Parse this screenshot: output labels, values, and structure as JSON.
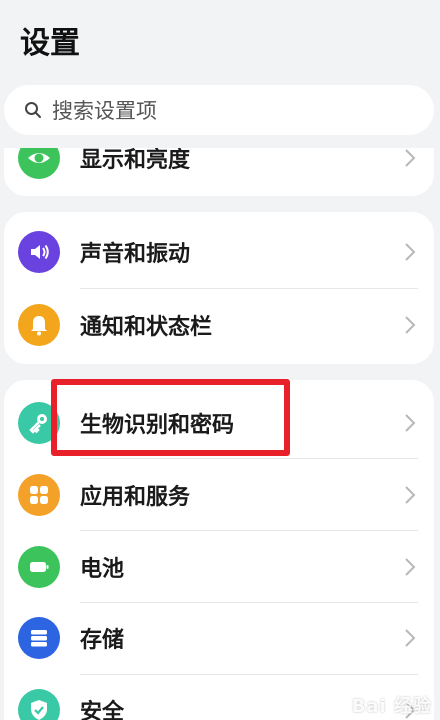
{
  "header": {
    "title": "设置"
  },
  "search": {
    "placeholder": "搜索设置项"
  },
  "groups": [
    {
      "items": [
        {
          "label": "显示和亮度",
          "icon": "eye-icon",
          "color": "#3cc35c"
        }
      ]
    },
    {
      "items": [
        {
          "label": "声音和振动",
          "icon": "speaker-icon",
          "color": "#6a42e0"
        },
        {
          "label": "通知和状态栏",
          "icon": "bell-icon",
          "color": "#f3a51c"
        }
      ]
    },
    {
      "items": [
        {
          "label": "生物识别和密码",
          "icon": "key-icon",
          "color": "#3ac9a6"
        },
        {
          "label": "应用和服务",
          "icon": "apps-grid-icon",
          "color": "#f4a12a"
        },
        {
          "label": "电池",
          "icon": "battery-icon",
          "color": "#3cc35c"
        },
        {
          "label": "存储",
          "icon": "storage-icon",
          "color": "#2c64e2"
        },
        {
          "label": "安全",
          "icon": "shield-icon",
          "color": "#3ac9a6"
        }
      ]
    }
  ],
  "watermark": {
    "text": "Bai 经验"
  }
}
